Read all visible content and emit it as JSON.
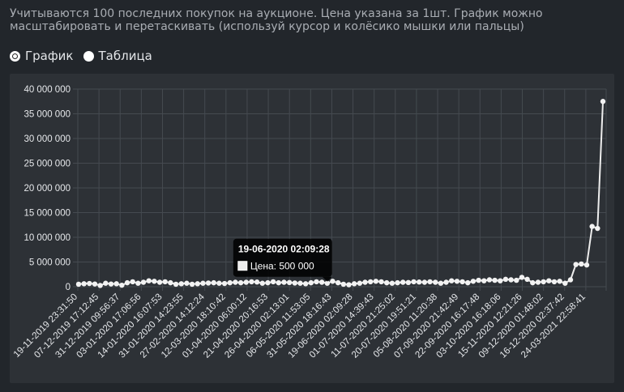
{
  "intro_text": "Учитываются 100 последних покупок на аукционе. Цена указана за 1шт. График можно масштабировать и перетаскивать (используй курсор и колёсико мышки или пальцы)",
  "view_switch": {
    "options": [
      {
        "label": "График",
        "checked": true
      },
      {
        "label": "Таблица",
        "checked": false
      }
    ]
  },
  "chart_data": {
    "type": "line",
    "title": "",
    "xlabel": "",
    "ylabel": "",
    "ylim": [
      0,
      40000000
    ],
    "y_ticks": [
      "0",
      "5 000 000",
      "10 000 000",
      "15 000 000",
      "20 000 000",
      "25 000 000",
      "30 000 000",
      "35 000 000",
      "40 000 000"
    ],
    "x_tick_labels": [
      "19-11-2019 23:31:50",
      "07-12-2019 17:12:45",
      "31-12-2019 09:56:37",
      "03-01-2020 17:06:56",
      "14-01-2020 16:07:53",
      "31-01-2020 14:23:55",
      "27-02-2020 14:12:24",
      "12-03-2020 18:10:42",
      "01-04-2020 06:00:12",
      "21-04-2020 20:16:53",
      "26-04-2020 02:13:01",
      "06-05-2020 11:53:05",
      "31-05-2020 18:16:43",
      "19-06-2020 02:09:28",
      "01-07-2020 14:39:43",
      "11-07-2020 21:25:02",
      "20-07-2020 19:51:21",
      "05-08-2020 11:20:38",
      "07-09-2020 21:42:49",
      "22-09-2020 16:17:48",
      "03-10-2020 16:18:06",
      "15-11-2020 12:21:26",
      "09-12-2020 01:48:02",
      "16-12-2020 02:37:42",
      "24-03-2021 22:58:41"
    ],
    "grid": true,
    "legend": "none",
    "line_color": "#ededed",
    "series": [
      {
        "name": "Цена",
        "values": [
          500000,
          600000,
          650000,
          550000,
          250000,
          700000,
          550000,
          600000,
          300000,
          800000,
          1000000,
          700000,
          900000,
          1200000,
          1100000,
          900000,
          1000000,
          800000,
          500000,
          600000,
          700000,
          500000,
          600000,
          700000,
          750000,
          800000,
          700000,
          650000,
          800000,
          900000,
          800000,
          900000,
          1000000,
          950000,
          700000,
          800000,
          1000000,
          800000,
          900000,
          850000,
          750000,
          700000,
          600000,
          800000,
          1000000,
          900000,
          700000,
          1100000,
          800000,
          500000,
          400000,
          600000,
          700000,
          900000,
          1000000,
          1100000,
          1000000,
          800000,
          700000,
          800000,
          900000,
          850000,
          1000000,
          950000,
          900000,
          1000000,
          900000,
          700000,
          900000,
          1200000,
          1100000,
          1000000,
          800000,
          1100000,
          1300000,
          1200000,
          1400000,
          1300000,
          1200000,
          1500000,
          1400000,
          1300000,
          1900000,
          1500000,
          800000,
          900000,
          1000000,
          1200000,
          1000000,
          1100000,
          700000,
          1400000,
          4500000,
          4600000,
          4400000,
          12200000,
          11800000,
          37500000
        ]
      }
    ],
    "tooltip": {
      "point_index": 46,
      "title": "19-06-2020 02:09:28",
      "label": "Цена: 500 000"
    }
  }
}
